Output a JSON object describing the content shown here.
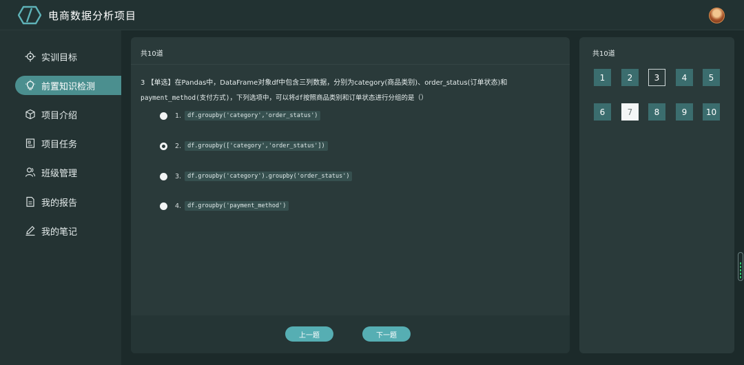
{
  "header": {
    "title": "电商数据分析项目",
    "logo_icon": "hexagon-logo-icon",
    "avatar_icon": "user-avatar"
  },
  "sidebar": {
    "items": [
      {
        "label": "实训目标",
        "icon": "target-icon"
      },
      {
        "label": "前置知识检测",
        "icon": "lightbulb-icon",
        "active": true
      },
      {
        "label": "项目介绍",
        "icon": "cube-icon"
      },
      {
        "label": "项目任务",
        "icon": "task-icon"
      },
      {
        "label": "班级管理",
        "icon": "users-icon"
      },
      {
        "label": "我的报告",
        "icon": "document-icon"
      },
      {
        "label": "我的笔记",
        "icon": "pen-icon"
      }
    ]
  },
  "quiz": {
    "total_label": "共10道",
    "question": {
      "number": "3",
      "type": "【单选】",
      "text_1": "在Pandas中，DataFrame对象df中包含三列数据，分别为category(商品类别)、order_status(订单状态)和",
      "text_2": "payment_method(支付方式)，下列选项中，可以将df按照商品类别和订单状态进行分组的是（）"
    },
    "options": [
      {
        "num": "1.",
        "code": "df.groupby('category','order_status')",
        "selected": false
      },
      {
        "num": "2.",
        "code": "df.groupby(['category','order_status'])",
        "selected": true
      },
      {
        "num": "3.",
        "code": "df.groupby('category').groupby('order_status')",
        "selected": false
      },
      {
        "num": "4.",
        "code": "df.groupby('payment_method')",
        "selected": false
      }
    ],
    "prev_label": "上一题",
    "next_label": "下一题"
  },
  "navigator": {
    "total_label": "共10道",
    "current": 3,
    "numbers": [
      "1",
      "2",
      "3",
      "4",
      "5",
      "6",
      "7",
      "8",
      "9",
      "10"
    ]
  },
  "colors": {
    "accent": "#56aeb3",
    "active_nav": "#4b8f8f",
    "panel": "#2a3a3a",
    "background": "#1c2a2a"
  }
}
